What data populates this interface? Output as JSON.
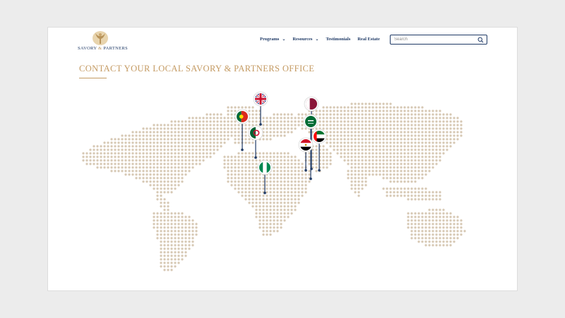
{
  "brand": {
    "name_left": "SAVORY",
    "name_amp": "&",
    "name_right": "PARTNERS",
    "accent": "#c49a62",
    "navy": "#1f3a66"
  },
  "nav": {
    "items": [
      {
        "label": "Programs",
        "has_dropdown": true
      },
      {
        "label": "Resources",
        "has_dropdown": true
      },
      {
        "label": "Testimonials",
        "has_dropdown": false
      },
      {
        "label": "Real Estate",
        "has_dropdown": false
      }
    ],
    "chevron": "⌄"
  },
  "search": {
    "placeholder": "Search",
    "icon": "search-icon"
  },
  "page": {
    "title": "CONTACT YOUR LOCAL SAVORY & PARTNERS OFFICE"
  },
  "map": {
    "dot_color": "#d6c8b3",
    "pin_color": "#1f3a66",
    "pins": [
      {
        "country": "United Kingdom",
        "icon": "flag-uk-icon"
      },
      {
        "country": "Portugal",
        "icon": "flag-portugal-icon"
      },
      {
        "country": "Algeria",
        "icon": "flag-algeria-icon"
      },
      {
        "country": "Nigeria",
        "icon": "flag-nigeria-icon"
      },
      {
        "country": "Qatar",
        "icon": "flag-qatar-icon"
      },
      {
        "country": "Saudi Arabia",
        "icon": "flag-saudi-icon"
      },
      {
        "country": "United Arab Emirates",
        "icon": "flag-uae-icon"
      },
      {
        "country": "Egypt",
        "icon": "flag-egypt-icon"
      }
    ]
  }
}
